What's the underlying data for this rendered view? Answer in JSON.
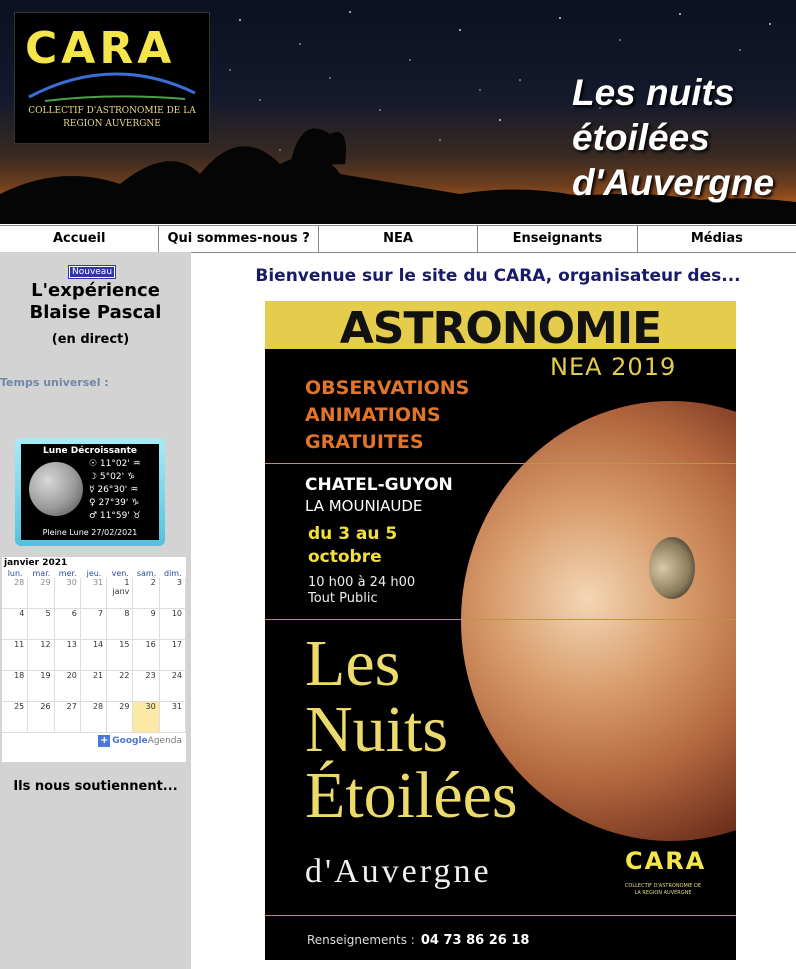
{
  "banner": {
    "logo_word": "CARA",
    "logo_line1": "COLLECTIF D'ASTRONOMIE DE LA",
    "logo_line2": "REGION AUVERGNE",
    "title_line1": "Les nuits",
    "title_line2": "étoilées",
    "title_line3": "d'Auvergne"
  },
  "nav": [
    "Accueil",
    "Qui sommes-nous ?",
    "NEA",
    "Enseignants",
    "Médias"
  ],
  "sidebar": {
    "badge": "Nouveau",
    "exp_line1": "L'expérience",
    "exp_line2": "Blaise Pascal",
    "exp_sub": "(en direct)",
    "temps_universel": "Temps universel :",
    "moon": {
      "title": "Lune Décroissante",
      "rows": [
        "☉ 11°02' ♒",
        "☽ 5°02' ♑",
        "☿ 26°30' ♒",
        "♀ 27°39' ♑",
        "♂ 11°59' ♉"
      ],
      "footer": "Pleine Lune 27/02/2021"
    },
    "calendar": {
      "month": "janvier 2021",
      "days": [
        "lun.",
        "mar.",
        "mer.",
        "jeu.",
        "ven.",
        "sam.",
        "dim."
      ],
      "cells": [
        "28",
        "29",
        "30",
        "31",
        "1 janv",
        "2",
        "3",
        "4",
        "5",
        "6",
        "7",
        "8",
        "9",
        "10",
        "11",
        "12",
        "13",
        "14",
        "15",
        "16",
        "17",
        "18",
        "19",
        "20",
        "21",
        "22",
        "23",
        "24",
        "25",
        "26",
        "27",
        "28",
        "29",
        "30",
        "31"
      ],
      "today_index": 33,
      "google": "Google",
      "agenda": "Agenda"
    },
    "sponsors": "Ils nous soutiennent..."
  },
  "main": {
    "welcome": "Bienvenue sur le site du CARA, organisateur des...",
    "poster": {
      "astronomie": "ASTRONOMIE",
      "nea": "NEA 2019",
      "obs1": "OBSERVATIONS",
      "obs2": "ANIMATIONS",
      "obs3": "GRATUITES",
      "city": "CHATEL-GUYON",
      "place": "LA MOUNIAUDE",
      "date1": "du 3 au 5",
      "date2": "octobre",
      "hours1": "10 h00 à 24 h00",
      "hours2": "Tout Public",
      "nuits1": "Les",
      "nuits2": "Nuits",
      "nuits3": "Étoilées",
      "auvergne": "d'Auvergne",
      "cara": "CARA",
      "cara_sub": "COLLECTIF D'ASTRONOMIE DE LA REGION AUVERGNE",
      "renseignements": "Renseignements :",
      "phone": "04 73 86 26 18"
    }
  },
  "colors": {
    "nav_border": "#888888",
    "sidebar_bg": "#d3d3d3",
    "welcome": "#1a1a66",
    "poster_gold": "#e4cc4c",
    "poster_orange": "#e0742a"
  }
}
